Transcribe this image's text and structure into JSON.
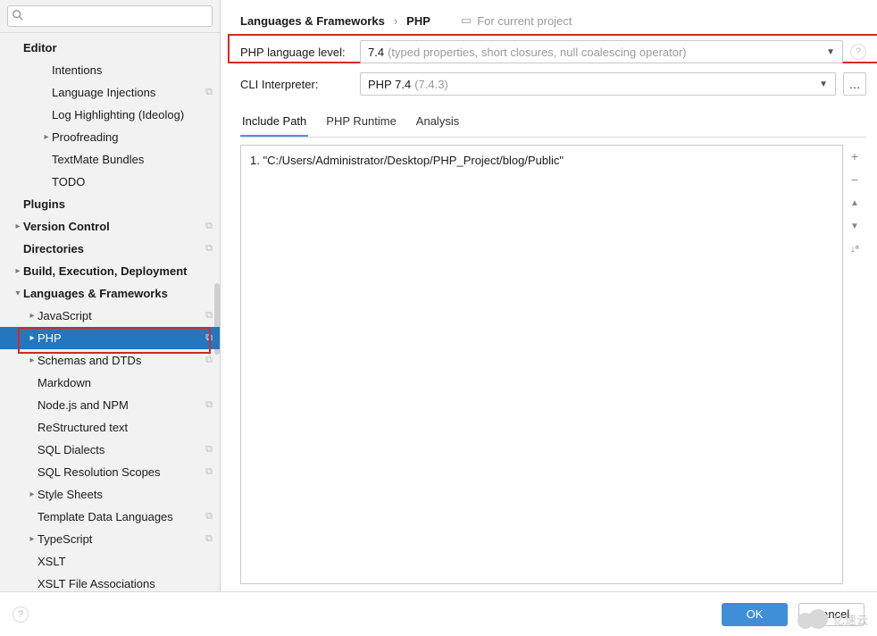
{
  "search": {
    "placeholder": ""
  },
  "tree": [
    {
      "label": "Editor",
      "level": 0,
      "bold": true,
      "arrow": "",
      "over": ""
    },
    {
      "label": "Intentions",
      "level": 2,
      "bold": false,
      "arrow": "",
      "over": ""
    },
    {
      "label": "Language Injections",
      "level": 2,
      "bold": false,
      "arrow": "",
      "over": "⧉"
    },
    {
      "label": "Log Highlighting (Ideolog)",
      "level": 2,
      "bold": false,
      "arrow": "",
      "over": ""
    },
    {
      "label": "Proofreading",
      "level": 2,
      "bold": false,
      "arrow": "▸",
      "over": ""
    },
    {
      "label": "TextMate Bundles",
      "level": 2,
      "bold": false,
      "arrow": "",
      "over": ""
    },
    {
      "label": "TODO",
      "level": 2,
      "bold": false,
      "arrow": "",
      "over": ""
    },
    {
      "label": "Plugins",
      "level": 0,
      "bold": true,
      "arrow": "",
      "over": ""
    },
    {
      "label": "Version Control",
      "level": 0,
      "bold": true,
      "arrow": "▸",
      "over": "⧉"
    },
    {
      "label": "Directories",
      "level": 0,
      "bold": true,
      "arrow": "",
      "over": "⧉"
    },
    {
      "label": "Build, Execution, Deployment",
      "level": 0,
      "bold": true,
      "arrow": "▸",
      "over": ""
    },
    {
      "label": "Languages & Frameworks",
      "level": 0,
      "bold": true,
      "arrow": "▾",
      "over": ""
    },
    {
      "label": "JavaScript",
      "level": 1,
      "bold": false,
      "arrow": "▸",
      "over": "⧉"
    },
    {
      "label": "PHP",
      "level": 1,
      "bold": false,
      "arrow": "▸",
      "over": "⧉",
      "selected": true
    },
    {
      "label": "Schemas and DTDs",
      "level": 1,
      "bold": false,
      "arrow": "▸",
      "over": "⧉"
    },
    {
      "label": "Markdown",
      "level": 1,
      "bold": false,
      "arrow": "",
      "over": ""
    },
    {
      "label": "Node.js and NPM",
      "level": 1,
      "bold": false,
      "arrow": "",
      "over": "⧉"
    },
    {
      "label": "ReStructured text",
      "level": 1,
      "bold": false,
      "arrow": "",
      "over": ""
    },
    {
      "label": "SQL Dialects",
      "level": 1,
      "bold": false,
      "arrow": "",
      "over": "⧉"
    },
    {
      "label": "SQL Resolution Scopes",
      "level": 1,
      "bold": false,
      "arrow": "",
      "over": "⧉"
    },
    {
      "label": "Style Sheets",
      "level": 1,
      "bold": false,
      "arrow": "▸",
      "over": ""
    },
    {
      "label": "Template Data Languages",
      "level": 1,
      "bold": false,
      "arrow": "",
      "over": "⧉"
    },
    {
      "label": "TypeScript",
      "level": 1,
      "bold": false,
      "arrow": "▸",
      "over": "⧉"
    },
    {
      "label": "XSLT",
      "level": 1,
      "bold": false,
      "arrow": "",
      "over": ""
    },
    {
      "label": "XSLT File Associations",
      "level": 1,
      "bold": false,
      "arrow": "",
      "over": ""
    }
  ],
  "breadcrumb": {
    "a": "Languages & Frameworks",
    "b": "PHP",
    "proj": "For current project"
  },
  "form": {
    "langLabel": "PHP language level:",
    "langValue": "7.4",
    "langHint": "(typed properties, short closures, null coalescing operator)",
    "cliLabel": "CLI Interpreter:",
    "cliValue": "PHP 7.4",
    "cliHint": "(7.4.3)"
  },
  "tabs": {
    "a": "Include Path",
    "b": "PHP Runtime",
    "c": "Analysis"
  },
  "paths": {
    "one": "1. \"C:/Users/Administrator/Desktop/PHP_Project/blog/Public\""
  },
  "tools": {
    "add": "+",
    "remove": "−",
    "up": "▲",
    "down": "▼",
    "sort": "↓ª"
  },
  "buttons": {
    "ok": "OK",
    "cancel": "Cancel"
  },
  "watermark": "亿速云"
}
